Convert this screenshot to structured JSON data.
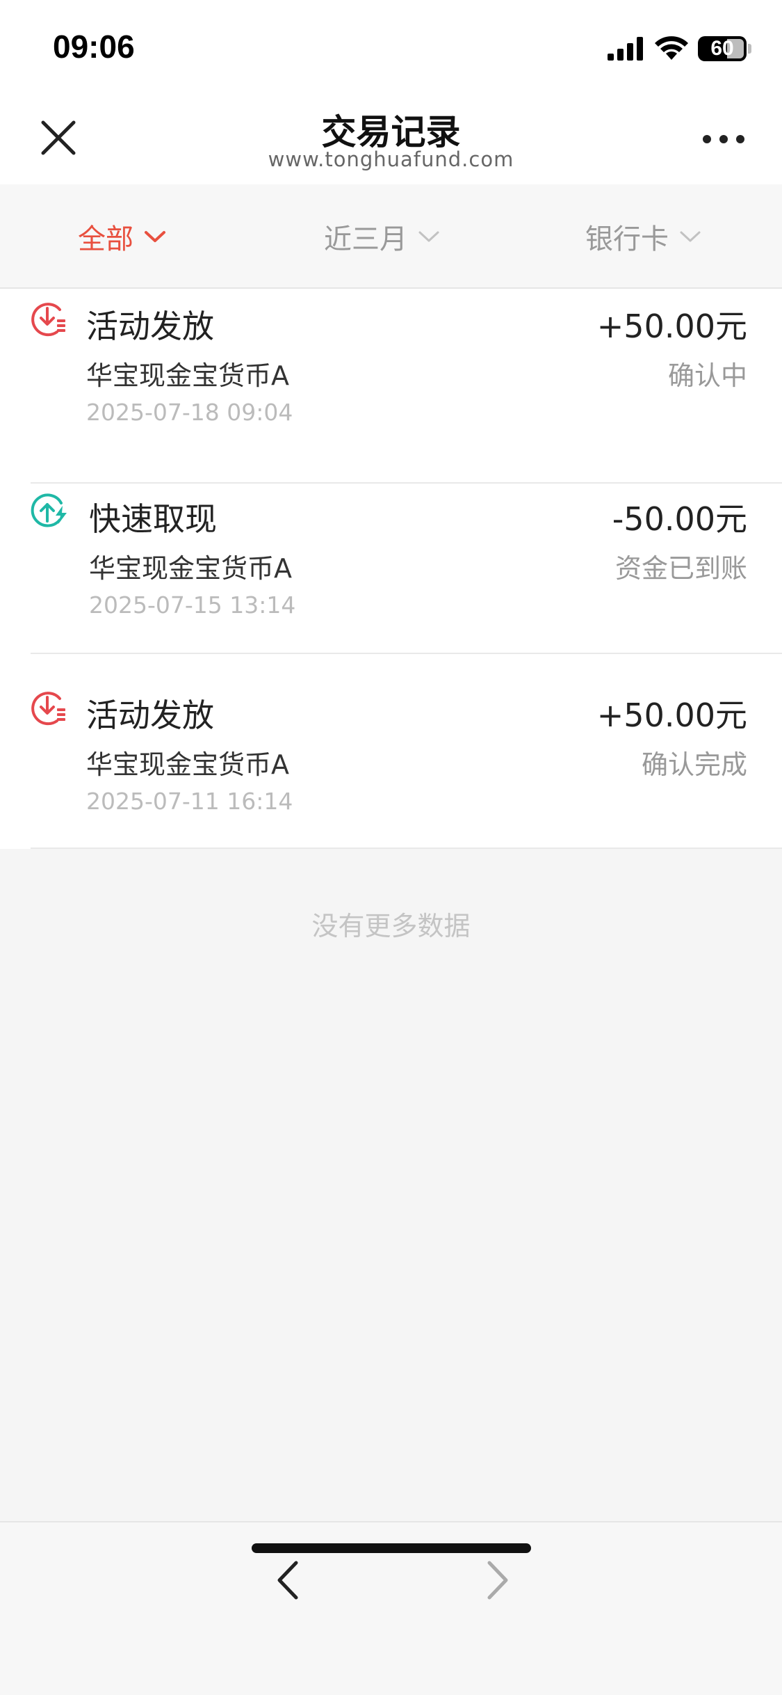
{
  "status_bar": {
    "time": "09:06",
    "battery": "60"
  },
  "header": {
    "title": "交易记录",
    "subtitle": "www.tonghuafund.com"
  },
  "filters": [
    {
      "label": "全部",
      "active": true
    },
    {
      "label": "近三月",
      "active": false
    },
    {
      "label": "银行卡",
      "active": false
    }
  ],
  "transactions": [
    {
      "icon": "deposit-icon",
      "type": "活动发放",
      "fund": "华宝现金宝货币A",
      "datetime": "2025-07-18 09:04",
      "amount": "+50.00元",
      "status": "确认中",
      "icon_color": "#e5484d"
    },
    {
      "icon": "withdraw-icon",
      "type": "快速取现",
      "fund": "华宝现金宝货币A",
      "datetime": "2025-07-15 13:14",
      "amount": "-50.00元",
      "status": "资金已到账",
      "icon_color": "#1fb8a6"
    },
    {
      "icon": "deposit-icon",
      "type": "活动发放",
      "fund": "华宝现金宝货币A",
      "datetime": "2025-07-11 16:14",
      "amount": "+50.00元",
      "status": "确认完成",
      "icon_color": "#e5484d"
    }
  ],
  "footer_text": "没有更多数据",
  "colors": {
    "accent": "#e8503f",
    "teal": "#1fb8a6",
    "red_icon": "#e5484d"
  }
}
